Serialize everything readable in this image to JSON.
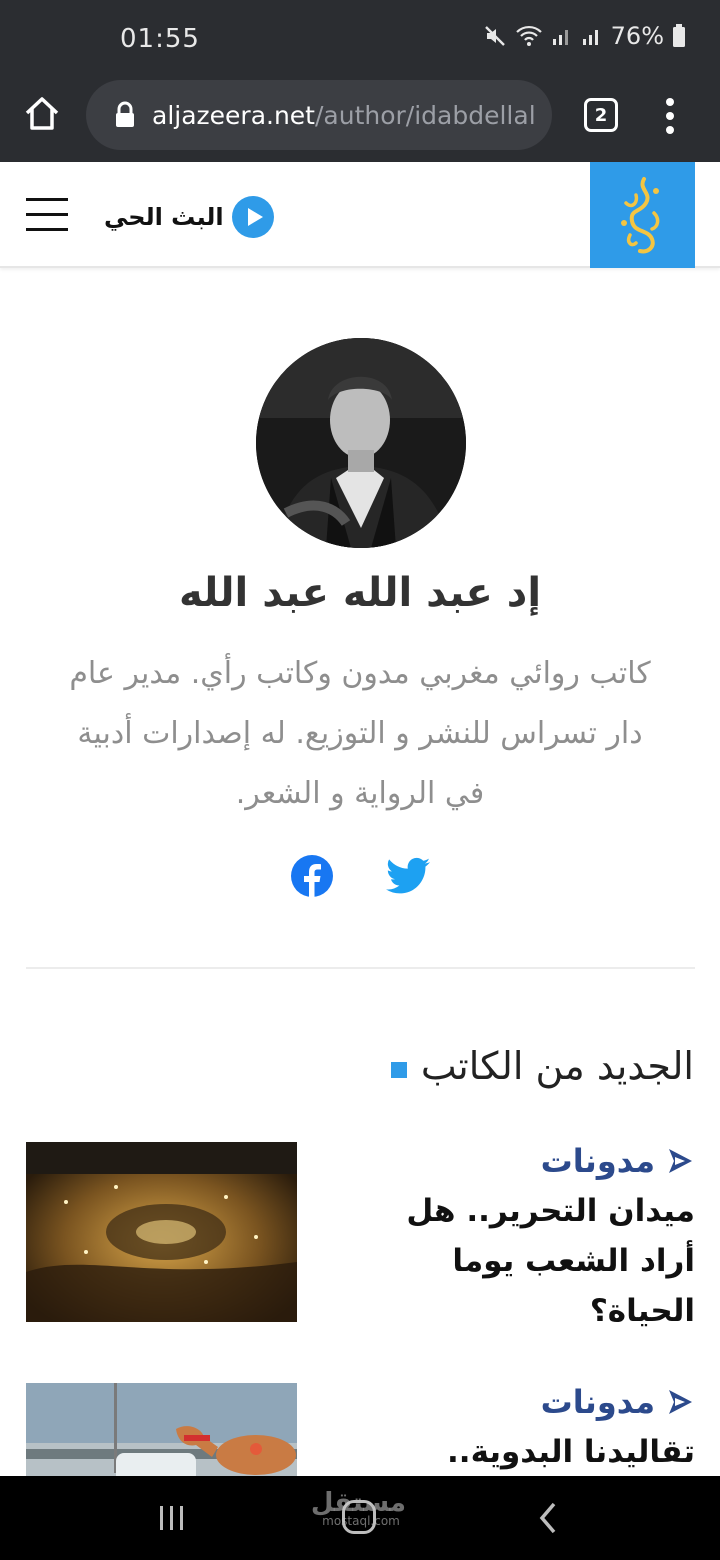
{
  "status_bar": {
    "time": "01:55",
    "battery": "76%"
  },
  "browser": {
    "url_domain": "aljazeera.net",
    "url_path": "/author/idabdellal",
    "tab_count": "2"
  },
  "site_header": {
    "live_label": "البث الحي",
    "brand_color": "#2f9be8"
  },
  "author": {
    "name": "إد عبد الله عبد الله",
    "bio": "كاتب روائي مغربي مدون وكاتب رأي. مدير عام دار تسراس للنشر و التوزيع. له إصدارات أدبية في الرواية و الشعر."
  },
  "latest": {
    "section_title": "الجديد من الكاتب",
    "articles": [
      {
        "category": "مدونات",
        "title": "ميدان التحرير.. هل أراد الشعب يوما الحياة؟"
      },
      {
        "category": "مدونات",
        "title": "تقاليدنا البدوية.."
      }
    ]
  },
  "watermark": {
    "main": "مستقل",
    "sub": "mostaql.com"
  },
  "colors": {
    "status_bg": "#2b2d31",
    "category_blue": "#2c4a8c",
    "accent": "#2f9be8"
  }
}
